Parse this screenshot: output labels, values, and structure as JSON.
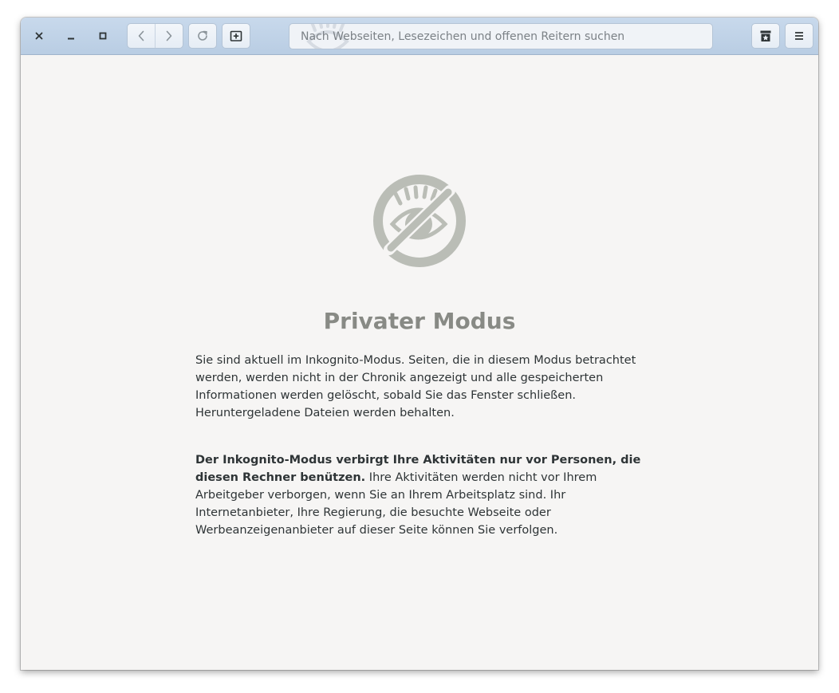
{
  "headerbar": {
    "close_icon": "close-icon",
    "minimize_icon": "minimize-icon",
    "maximize_icon": "maximize-icon",
    "back_icon": "chevron-left-icon",
    "forward_icon": "chevron-right-icon",
    "reload_icon": "reload-icon",
    "new_tab_icon": "new-tab-icon",
    "bookmarks_icon": "bookmarks-icon",
    "menu_icon": "hamburger-menu-icon"
  },
  "urlbar": {
    "placeholder": "Nach Webseiten, Lesezeichen und offenen Reitern suchen",
    "value": ""
  },
  "page": {
    "title": "Privater Modus",
    "paragraph1": "Sie sind aktuell im Inkognito-Modus. Seiten, die in diesem Modus betrachtet werden, werden nicht in der Chronik angezeigt und alle gespeicherten Informationen werden gelöscht, sobald Sie das Fenster schließen. Heruntergeladene Dateien werden behalten.",
    "paragraph2_bold": "Der Inkognito-Modus verbirgt Ihre Aktivitäten nur vor Personen, die diesen Rechner benützen.",
    "paragraph2_rest": " Ihre Aktivitäten werden nicht vor Ihrem Arbeitgeber verborgen, wenn Sie an Ihrem Arbeitsplatz sind. Ihr Internetanbieter, Ihre Regierung, die besuchte Webseite oder Werbeanzeigenanbieter auf dieser Seite können Sie verfolgen.",
    "hero_icon": "incognito-eye-crossed-icon"
  },
  "colors": {
    "headerbar": "#bfd3e8",
    "content_bg": "#f6f5f4",
    "title": "#888a85",
    "icon": "#babdb6",
    "text": "#2e3436"
  }
}
